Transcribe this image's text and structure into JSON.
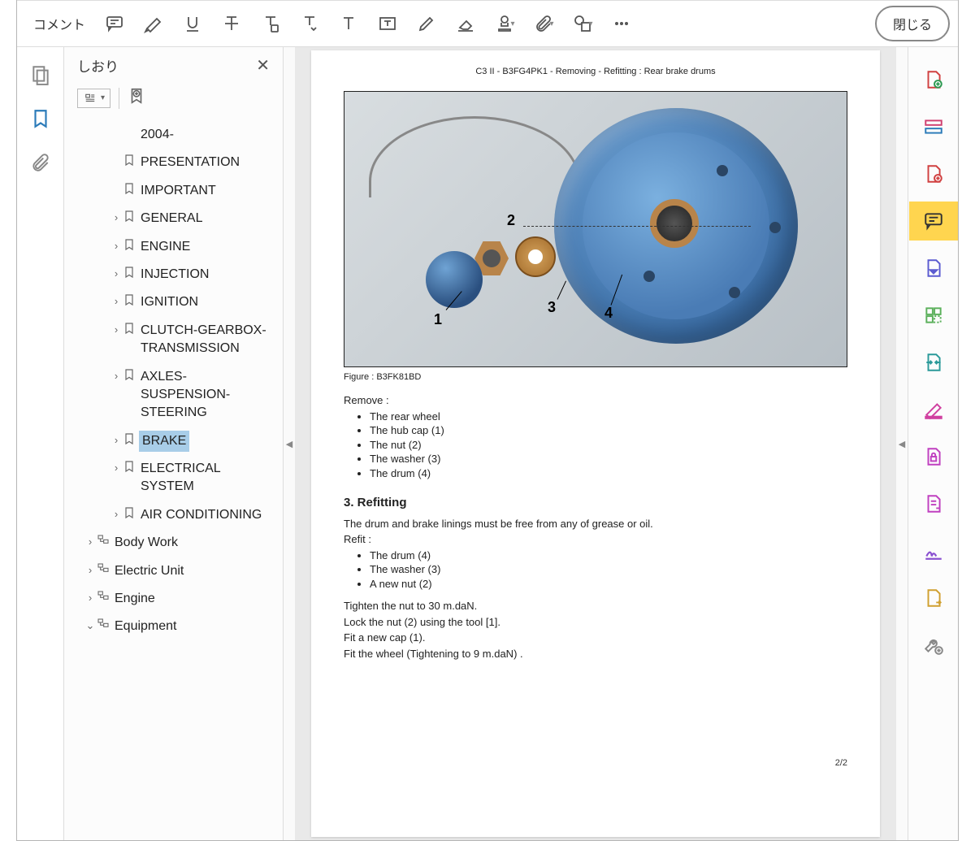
{
  "toolbar": {
    "label": "コメント",
    "close": "閉じる"
  },
  "bookmarks": {
    "title": "しおり",
    "items": [
      {
        "label": "2004-",
        "indent": 2,
        "chev": "",
        "icon": "none"
      },
      {
        "label": "PRESENTATION",
        "indent": 2,
        "chev": "",
        "icon": "bm"
      },
      {
        "label": "IMPORTANT",
        "indent": 2,
        "chev": "",
        "icon": "bm"
      },
      {
        "label": "GENERAL",
        "indent": 2,
        "chev": "›",
        "icon": "bm"
      },
      {
        "label": "ENGINE",
        "indent": 2,
        "chev": "›",
        "icon": "bm"
      },
      {
        "label": "INJECTION",
        "indent": 2,
        "chev": "›",
        "icon": "bm"
      },
      {
        "label": "IGNITION",
        "indent": 2,
        "chev": "›",
        "icon": "bm"
      },
      {
        "label": "CLUTCH-GEARBOX-TRANSMISSION",
        "indent": 2,
        "chev": "›",
        "icon": "bm"
      },
      {
        "label": "AXLES-SUSPENSION-STEERING",
        "indent": 2,
        "chev": "›",
        "icon": "bm"
      },
      {
        "label": "BRAKE",
        "indent": 2,
        "chev": "›",
        "icon": "bm",
        "selected": true
      },
      {
        "label": "ELECTRICAL SYSTEM",
        "indent": 2,
        "chev": "›",
        "icon": "bm"
      },
      {
        "label": "AIR CONDITIONING",
        "indent": 2,
        "chev": "›",
        "icon": "bm"
      },
      {
        "label": "Body Work",
        "indent": 1,
        "chev": "›",
        "icon": "tree"
      },
      {
        "label": "Electric Unit",
        "indent": 1,
        "chev": "›",
        "icon": "tree"
      },
      {
        "label": "Engine",
        "indent": 1,
        "chev": "›",
        "icon": "tree"
      },
      {
        "label": "Equipment",
        "indent": 1,
        "chev": "⌄",
        "icon": "tree"
      }
    ]
  },
  "doc": {
    "header": "C3 II - B3FG4PK1 - Removing - Refitting : Rear brake drums",
    "figCaption": "Figure : B3FK81BD",
    "removeTitle": "Remove :",
    "removeItems": [
      "The rear wheel",
      "The hub cap (1)",
      "The nut (2)",
      "The washer (3)",
      "The drum (4)"
    ],
    "refitHeading": "3. Refitting",
    "refitLine1": "The drum and brake linings must be free from any of grease or oil.",
    "refitTitle": "Refit :",
    "refitItems": [
      "The drum (4)",
      "The washer (3)",
      "A new nut (2)"
    ],
    "afterLines": [
      "Tighten the nut to 30 m.daN.",
      "Lock the nut (2) using the tool [1].",
      "Fit a new cap (1).",
      "Fit the wheel (Tightening to 9 m.daN) ."
    ],
    "pageNum": "2/2",
    "figLabels": {
      "n1": "1",
      "n2": "2",
      "n3": "3",
      "n4": "4"
    }
  }
}
